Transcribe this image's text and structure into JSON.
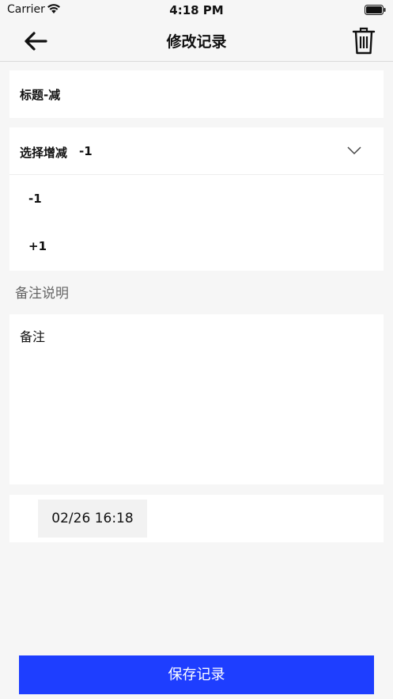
{
  "status_bar": {
    "carrier": "Carrier",
    "time": "4:18 PM",
    "icons": [
      "wifi-icon",
      "battery-icon"
    ]
  },
  "nav": {
    "title": "修改记录",
    "back_icon": "arrow-left-icon",
    "delete_icon": "trash-icon"
  },
  "form": {
    "title_value": "标题-减",
    "select": {
      "label": "选择增减",
      "value": "-1",
      "options": [
        "-1",
        "+1"
      ]
    },
    "remark_label": "备注说明",
    "remark_value": "备注",
    "date": "02/26 16:18"
  },
  "save_label": "保存记录",
  "colors": {
    "accent": "#1e3eff",
    "background": "#f6f6f6",
    "card": "#ffffff"
  }
}
